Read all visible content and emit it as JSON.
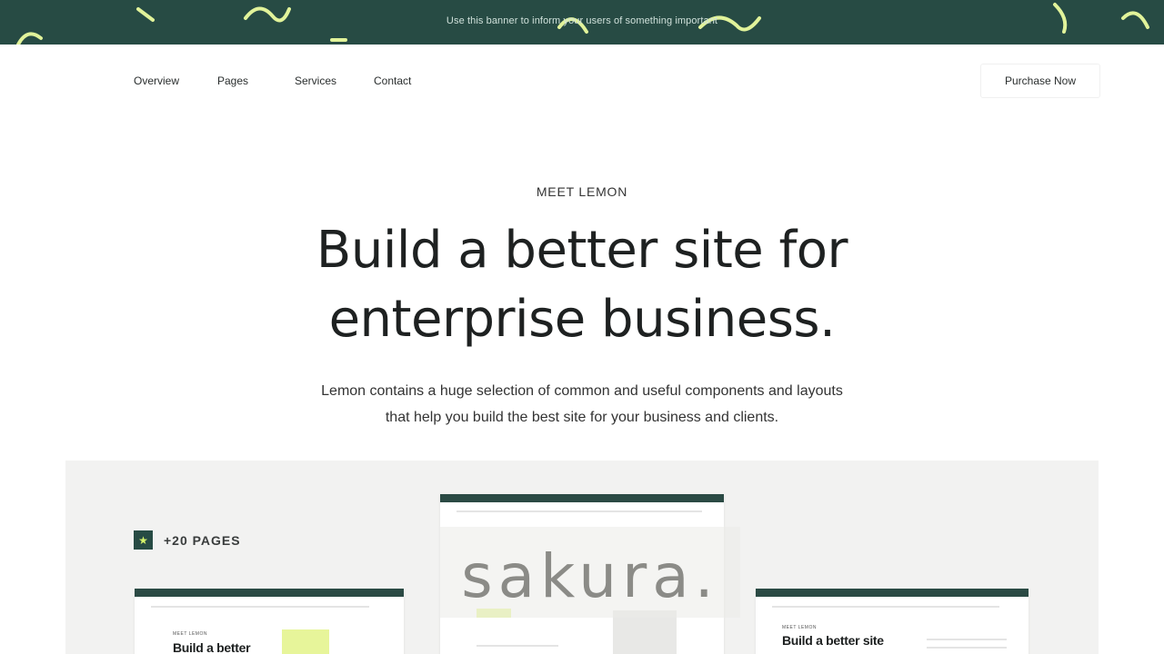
{
  "banner": {
    "text": "Use this banner to inform your users of something important"
  },
  "nav": {
    "items": [
      {
        "label": "Overview"
      },
      {
        "label": "Pages"
      },
      {
        "label": "Services"
      },
      {
        "label": "Contact"
      }
    ],
    "cta_label": "Purchase Now"
  },
  "hero": {
    "eyebrow": "MEET LEMON",
    "headline_line1": "Build a better site for",
    "headline_line2": "enterprise business.",
    "subtext_line1": "Lemon contains a huge selection of common and useful components and layouts",
    "subtext_line2": "that help you build the best site for your business and clients."
  },
  "showcase": {
    "badge_icon": "star-icon",
    "badge_label": "+20 PAGES",
    "left_thumb": {
      "eyebrow": "MEET LEMON",
      "headline": "Build a better"
    },
    "right_thumb": {
      "eyebrow": "MEET LEMON",
      "headline": "Build a better site"
    }
  },
  "watermark": {
    "text": "sakura."
  },
  "colors": {
    "brand_dark_green": "#274b44",
    "accent_lime": "#d6f36a",
    "showcase_bg": "#f2f2f1"
  }
}
